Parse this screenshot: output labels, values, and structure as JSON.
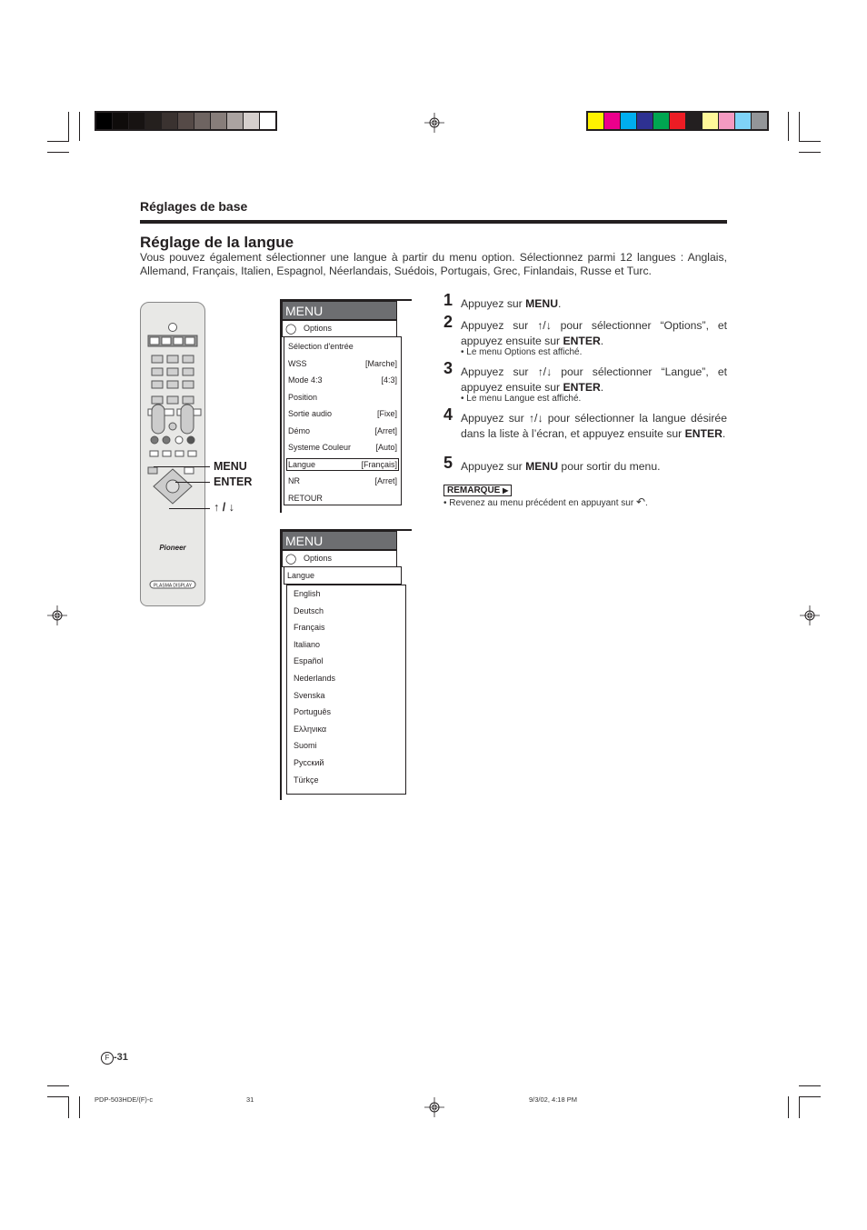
{
  "printer_marks": {
    "grayscale_bar": [
      "#000000",
      "#0f0c0b",
      "#171312",
      "#25201e",
      "#3a3230",
      "#554a47",
      "#6e6461",
      "#877d7a",
      "#aba3a1",
      "#d6cfcd",
      "#ffffff"
    ],
    "color_bar": [
      "#fff200",
      "#ec008c",
      "#00aeef",
      "#2e3192",
      "#00a651",
      "#ed1c24",
      "#231f20",
      "#fff799",
      "#f49ac1",
      "#7fd3f7",
      "#939598"
    ]
  },
  "header": {
    "section": "Réglages de base",
    "title": "Réglage de la langue",
    "intro": "Vous pouvez également sélectionner une langue à partir du menu option. Sélectionnez parmi 12 langues : Anglais, Allemand, Français, Italien, Espagnol, Néerlandais, Suédois, Portugais, Grec, Finlandais, Russe et Turc."
  },
  "remote": {
    "brand": "Pioneer",
    "label": "PLASMA DISPLAY",
    "callouts": {
      "menu": "MENU",
      "enter": "ENTER",
      "arrows": "↑ / ↓"
    }
  },
  "menu1": {
    "title": "MENU",
    "tab": "Options",
    "rows": [
      {
        "label": "Sélection d'entrée",
        "value": ""
      },
      {
        "label": "WSS",
        "value": "[Marche]"
      },
      {
        "label": "Mode 4:3",
        "value": "[4:3]"
      },
      {
        "label": "Position",
        "value": ""
      },
      {
        "label": "Sortie audio",
        "value": "[Fixe]"
      },
      {
        "label": "Démo",
        "value": "[Arret]"
      },
      {
        "label": "Systeme Couleur",
        "value": "[Auto]"
      },
      {
        "label": "Langue",
        "value": "[Français]"
      },
      {
        "label": "NR",
        "value": "[Arret]"
      },
      {
        "label": "RETOUR",
        "value": ""
      }
    ],
    "selected_index": 7
  },
  "menu2": {
    "title": "MENU",
    "tab": "Options",
    "submenu": "Langue",
    "languages": [
      "English",
      "Deutsch",
      "Français",
      "Italiano",
      "Español",
      "Nederlands",
      "Svenska",
      "Português",
      "Ελληνικα",
      "Suomi",
      "Русский",
      "Türkçe"
    ]
  },
  "steps": [
    {
      "num": "1",
      "pre": "Appuyez sur ",
      "bold": "MENU",
      "post": "."
    },
    {
      "num": "2",
      "pre": "Appuyez sur ↑/↓ pour sélectionner “Options”, et appuyez ensuite sur ",
      "bold": "ENTER",
      "post": ".",
      "note": "• Le menu Options est affiché."
    },
    {
      "num": "3",
      "pre": "Appuyez sur ↑/↓ pour sélectionner “Langue”, et appuyez ensuite sur  ",
      "bold": "ENTER",
      "post": ".",
      "note": "• Le menu Langue est affiché."
    },
    {
      "num": "4",
      "pre": "Appuyez sur ↑/↓ pour sélectionner la langue désirée dans la liste à l’écran, et appuyez ensuite sur ",
      "bold": "ENTER",
      "post": "."
    },
    {
      "num": "5",
      "pre": "Appuyez sur ",
      "bold": "MENU",
      "post": " pour sortir du menu."
    }
  ],
  "remarque": {
    "label": "REMARQUE",
    "text": "• Revenez au menu précédent en appuyant sur"
  },
  "footer": {
    "page_badge": "F",
    "page_number": "-31",
    "file": "PDP-503HDE/(F)-c",
    "page": "31",
    "timestamp": "9/3/02, 4:18 PM"
  }
}
